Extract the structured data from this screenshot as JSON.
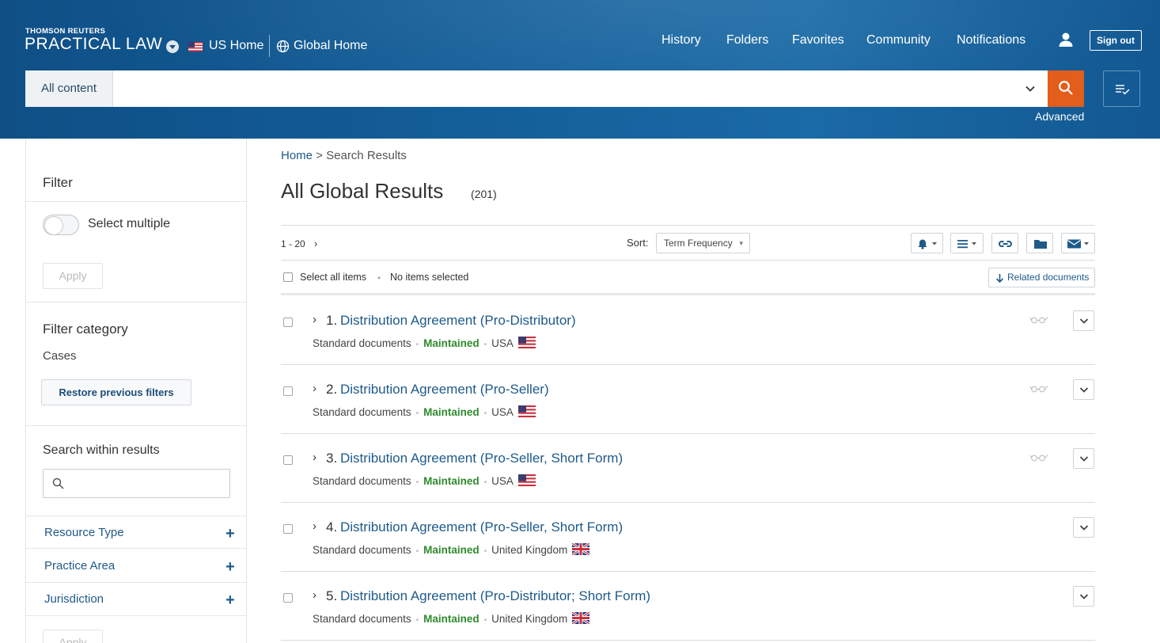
{
  "header": {
    "brand_small": "THOMSON REUTERS",
    "brand_large": "PRACTICAL LAW",
    "us_home": "US Home",
    "global_home": "Global Home",
    "nav": [
      "History",
      "Folders",
      "Favorites",
      "Community",
      "Notifications"
    ],
    "sign_out": "Sign out",
    "icons": [
      "brand-caret-icon",
      "us-flag-icon",
      "globe-icon",
      "user-icon",
      "search-icon",
      "chevron-down-icon",
      "list-check-icon"
    ],
    "brand_color": "#14609b",
    "accent_color": "#e35d1b"
  },
  "search": {
    "scope": "All content",
    "value": "",
    "advanced": "Advanced"
  },
  "sidebar": {
    "filter_title": "Filter",
    "select_multiple": "Select multiple",
    "apply": "Apply",
    "filter_category_title": "Filter category",
    "filter_category_value": "Cases",
    "restore": "Restore previous filters",
    "search_within_title": "Search within results",
    "search_within_value": "",
    "facets": [
      "Resource Type",
      "Practice Area",
      "Jurisdiction"
    ],
    "apply_bottom": "Apply"
  },
  "main": {
    "breadcrumb_home": "Home",
    "breadcrumb_sep": " > ",
    "breadcrumb_current": "Search Results",
    "title": "All Global Results",
    "count": "(201)",
    "pager": "1 - 20",
    "sort_label": "Sort:",
    "sort_value": "Term Frequency",
    "select_all": "Select all items",
    "sel_sep": "•",
    "no_items": "No items selected",
    "related": "Related documents",
    "results": [
      {
        "num": "1.",
        "title": "Distribution Agreement (Pro-Distributor)",
        "type": "Standard documents",
        "status": "Maintained",
        "jurisdiction": "USA",
        "flag": "us"
      },
      {
        "num": "2.",
        "title": "Distribution Agreement (Pro-Seller)",
        "type": "Standard documents",
        "status": "Maintained",
        "jurisdiction": "USA",
        "flag": "us"
      },
      {
        "num": "3.",
        "title": "Distribution Agreement (Pro-Seller, Short Form)",
        "type": "Standard documents",
        "status": "Maintained",
        "jurisdiction": "USA",
        "flag": "us"
      },
      {
        "num": "4.",
        "title": "Distribution Agreement (Pro-Seller, Short Form)",
        "type": "Standard documents",
        "status": "Maintained",
        "jurisdiction": "United Kingdom",
        "flag": "uk"
      },
      {
        "num": "5.",
        "title": "Distribution Agreement (Pro-Distributor; Short Form)",
        "type": "Standard documents",
        "status": "Maintained",
        "jurisdiction": "United Kingdom",
        "flag": "uk"
      }
    ]
  }
}
